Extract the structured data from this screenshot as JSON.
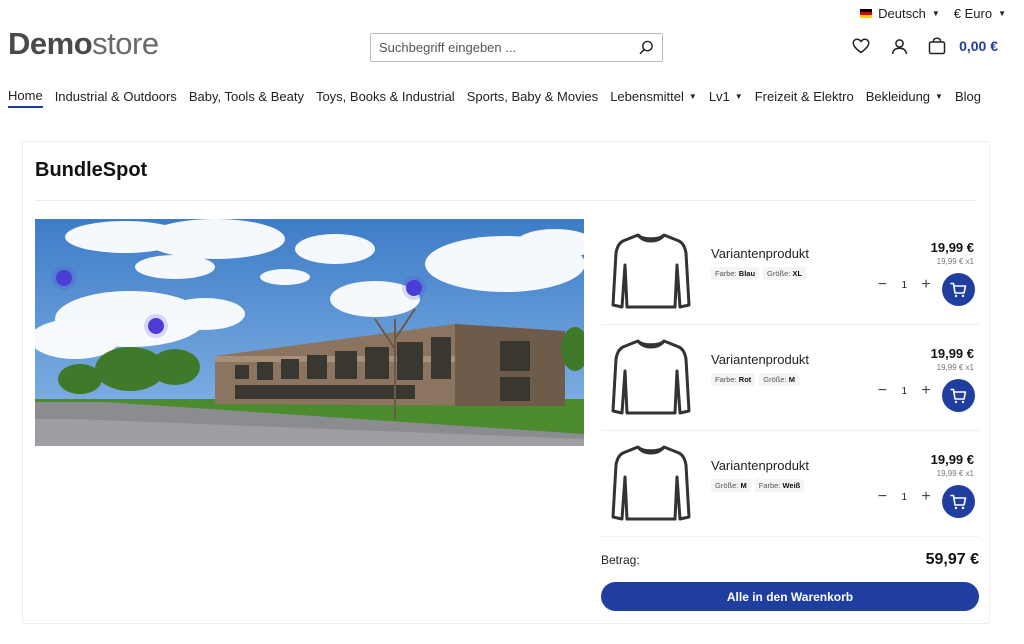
{
  "topbar": {
    "language": "Deutsch",
    "currency": "€ Euro"
  },
  "header": {
    "logo_bold": "Demo",
    "logo_light": "store",
    "search_placeholder": "Suchbegriff eingeben ...",
    "cart_total": "0,00 €"
  },
  "nav": {
    "items": [
      {
        "label": "Home",
        "active": true,
        "dropdown": false
      },
      {
        "label": "Industrial & Outdoors",
        "dropdown": false
      },
      {
        "label": "Baby, Tools & Beaty",
        "dropdown": false
      },
      {
        "label": "Toys, Books & Industrial",
        "dropdown": false
      },
      {
        "label": "Sports, Baby & Movies",
        "dropdown": false
      },
      {
        "label": "Lebensmittel",
        "dropdown": true
      },
      {
        "label": "Lv1",
        "dropdown": true
      },
      {
        "label": "Freizeit & Elektro",
        "dropdown": false
      },
      {
        "label": "Bekleidung",
        "dropdown": true
      },
      {
        "label": "Blog",
        "dropdown": false
      }
    ]
  },
  "bundle": {
    "title": "BundleSpot",
    "products": [
      {
        "name": "Variantenprodukt",
        "tags": [
          {
            "key": "Farbe:",
            "value": "Blau"
          },
          {
            "key": "Größe:",
            "value": "XL"
          }
        ],
        "price": "19,99 €",
        "unit": "19,99 € x1",
        "qty": "1"
      },
      {
        "name": "Variantenprodukt",
        "tags": [
          {
            "key": "Farbe:",
            "value": "Rot"
          },
          {
            "key": "Größe:",
            "value": "M"
          }
        ],
        "price": "19,99 €",
        "unit": "19,99 € x1",
        "qty": "1"
      },
      {
        "name": "Variantenprodukt",
        "tags": [
          {
            "key": "Größe:",
            "value": "M"
          },
          {
            "key": "Farbe:",
            "value": "Weiß"
          }
        ],
        "price": "19,99 €",
        "unit": "19,99 € x1",
        "qty": "1"
      }
    ],
    "total_label": "Betrag:",
    "total_amount": "59,97 €",
    "add_all_label": "Alle in den Warenkorb"
  },
  "colors": {
    "accent": "#1f3ea0",
    "hotspot": "#4c3dd6"
  }
}
